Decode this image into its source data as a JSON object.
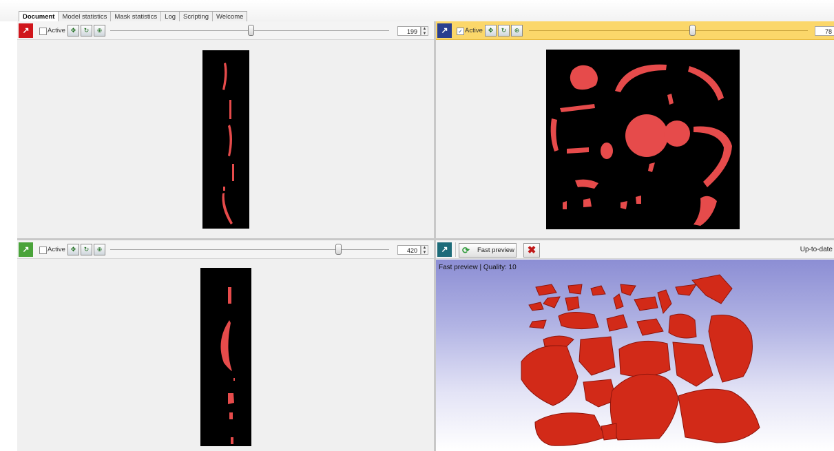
{
  "tabs": [
    {
      "label": "Document",
      "active": true
    },
    {
      "label": "Model statistics",
      "active": false
    },
    {
      "label": "Mask statistics",
      "active": false
    },
    {
      "label": "Log",
      "active": false
    },
    {
      "label": "Scripting",
      "active": false
    },
    {
      "label": "Welcome",
      "active": false
    }
  ],
  "views": {
    "top_left": {
      "active_label": "Active",
      "active_checked": false,
      "slice_value": "199",
      "slider_fraction": 0.49,
      "accent_color": "#d0161c"
    },
    "top_right": {
      "active_label": "Active",
      "active_checked": true,
      "slice_value": "78",
      "slider_fraction": 0.59,
      "accent_color": "#2a3f8f",
      "highlight_color": "#fbd76a"
    },
    "bottom_left": {
      "active_label": "Active",
      "active_checked": false,
      "slice_value": "420",
      "slider_fraction": 0.82,
      "accent_color": "#4aa33a"
    },
    "preview_3d": {
      "accent_color": "#1d6b79",
      "fast_preview_label": "Fast preview",
      "status_text": "Up-to-date",
      "overlay_text": "Fast preview | Quality: 10",
      "refresh_icon": "refresh-icon",
      "cancel_icon": "cancel-icon"
    }
  },
  "icons": {
    "maximize": "maximize-icon",
    "view_tools": [
      "pan-icon",
      "rotate-icon",
      "zoom-icon"
    ]
  },
  "colors": {
    "mask_red": "#e64b4b",
    "render_red": "#d22a18",
    "slice_background": "#000000"
  }
}
